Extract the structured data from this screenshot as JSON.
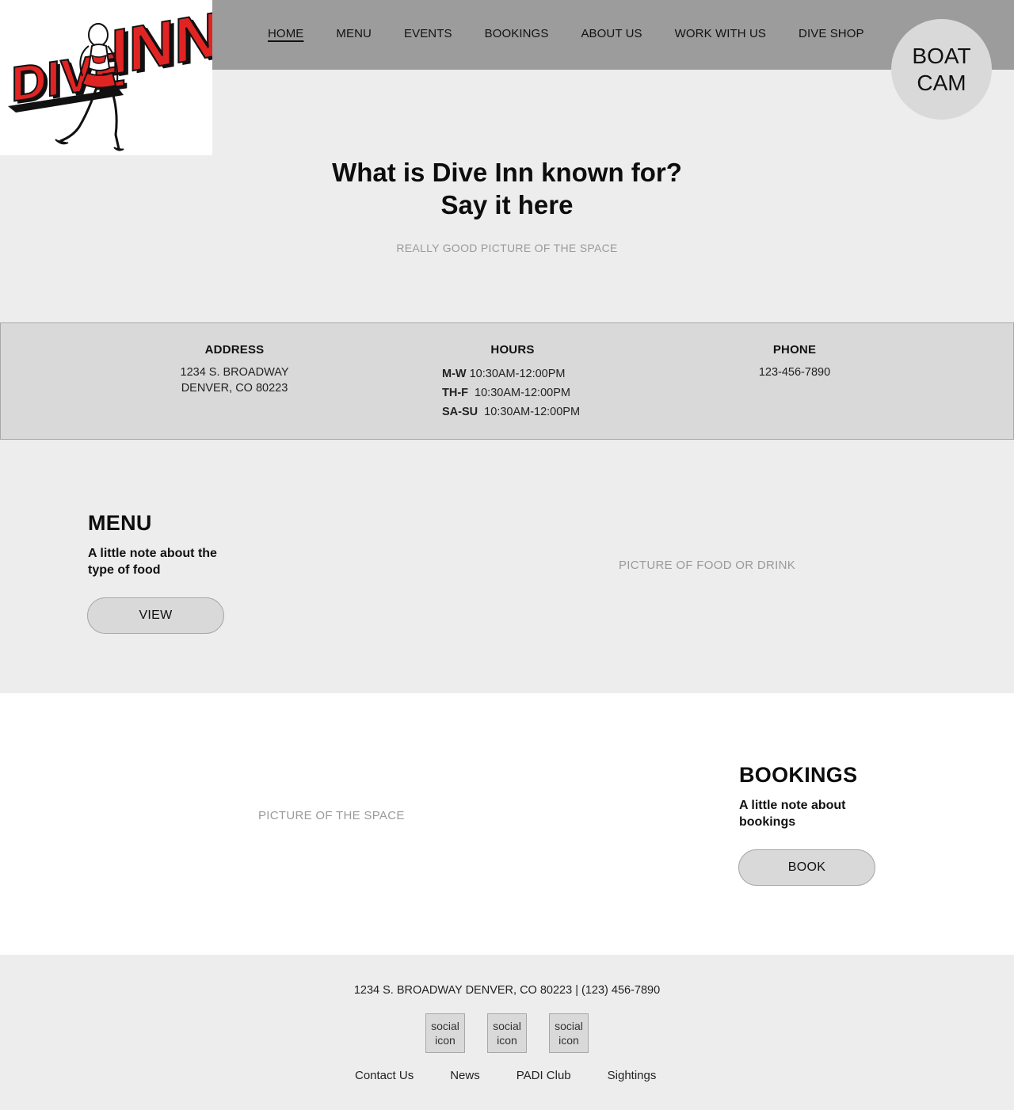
{
  "logo": {
    "alt": "DIVE INN",
    "word1": "DIVE",
    "word2": "INN"
  },
  "nav": {
    "items": [
      {
        "label": "HOME"
      },
      {
        "label": "MENU"
      },
      {
        "label": "EVENTS"
      },
      {
        "label": "BOOKINGS"
      },
      {
        "label": "ABOUT US"
      },
      {
        "label": "WORK WITH US"
      },
      {
        "label": "DIVE SHOP"
      }
    ],
    "active_index": 0
  },
  "boat_cam": {
    "line1": "BOAT",
    "line2": "CAM"
  },
  "hero": {
    "heading_line1": "What is Dive Inn known for?",
    "heading_line2": "Say it here",
    "image_caption": "REALLY GOOD PICTURE OF THE SPACE"
  },
  "info": {
    "address": {
      "title": "ADDRESS",
      "line1": "1234 S. BROADWAY",
      "line2": "DENVER, CO 80223"
    },
    "hours": {
      "title": "HOURS",
      "rows": [
        {
          "days": "M-W",
          "time": "10:30AM-12:00PM"
        },
        {
          "days": "TH-F",
          "time": "10:30AM-12:00PM"
        },
        {
          "days": "SA-SU",
          "time": "10:30AM-12:00PM"
        }
      ]
    },
    "phone": {
      "title": "PHONE",
      "number": "123-456-7890"
    }
  },
  "menu_section": {
    "title": "MENU",
    "note": "A little note about the type of food",
    "button_label": "VIEW",
    "image_caption": "PICTURE OF FOOD OR DRINK"
  },
  "bookings_section": {
    "title": "BOOKINGS",
    "note": "A little note about bookings",
    "button_label": "BOOK",
    "image_caption": "PICTURE OF THE SPACE"
  },
  "footer": {
    "address_line": "1234 S. BROADWAY DENVER, CO 80223 | (123) 456-7890",
    "socials": [
      {
        "line1": "social",
        "line2": "icon"
      },
      {
        "line1": "social",
        "line2": "icon"
      },
      {
        "line1": "social",
        "line2": "icon"
      }
    ],
    "links": [
      {
        "label": "Contact Us"
      },
      {
        "label": "News"
      },
      {
        "label": "PADI Club"
      },
      {
        "label": "Sightings"
      }
    ]
  },
  "colors": {
    "topbar": "#9c9c9c",
    "page_bg": "#ededed",
    "panel": "#d9d9d9",
    "logo_red": "#e02424",
    "placeholder_text": "#9a9a9a"
  }
}
